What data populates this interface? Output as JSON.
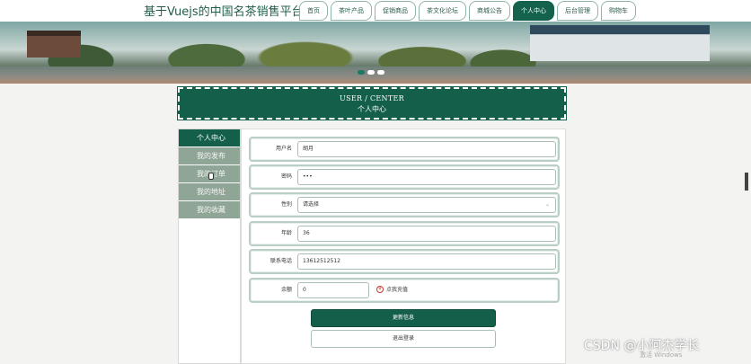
{
  "site": {
    "title": "基于Vuejs的中国名茶销售平台"
  },
  "nav": [
    {
      "label": "首页"
    },
    {
      "label": "茶叶产品"
    },
    {
      "label": "促销商品"
    },
    {
      "label": "茶文化论坛"
    },
    {
      "label": "商城公告"
    },
    {
      "label": "个人中心",
      "active": true
    },
    {
      "label": "后台管理"
    },
    {
      "label": "购物车"
    }
  ],
  "banner": {
    "slides": 3,
    "active_slide": 1
  },
  "center": {
    "title_en": "USER / CENTER",
    "title_zh": "个人中心"
  },
  "sidemenu": {
    "head": "个人中心",
    "items": [
      {
        "label": "我的发布"
      },
      {
        "label": "我的订单"
      },
      {
        "label": "我的地址"
      },
      {
        "label": "我的收藏"
      }
    ]
  },
  "form": {
    "username": {
      "label": "用户名",
      "value": "胡月"
    },
    "password": {
      "label": "密码",
      "value": "•••"
    },
    "gender": {
      "label": "性别",
      "placeholder": "请选择"
    },
    "age": {
      "label": "年龄",
      "value": "36"
    },
    "phone": {
      "label": "联系电话",
      "value": "13612512512"
    },
    "balance": {
      "label": "余额",
      "value": "0",
      "recharge": "点我充值"
    },
    "update_button": "更新信息",
    "logout_button": "退出登录"
  },
  "watermark": {
    "text": "CSDN @小阿杰学长",
    "sub": "激活 Windows"
  },
  "colors": {
    "primary": "#145f4a",
    "menu_item": "#8fa595",
    "accent_red": "#c0392b"
  }
}
